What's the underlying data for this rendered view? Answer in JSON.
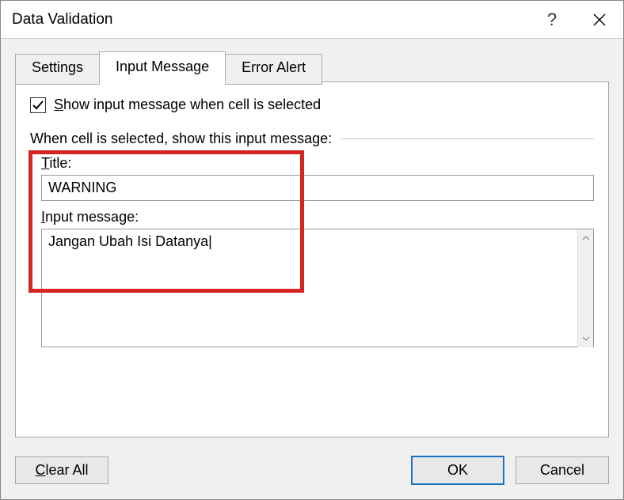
{
  "titlebar": {
    "title": "Data Validation",
    "help": "?",
    "close": "×"
  },
  "tabs": {
    "settings": "Settings",
    "input_message": "Input Message",
    "error_alert": "Error Alert"
  },
  "panel": {
    "checkbox_label_pre": "S",
    "checkbox_label_post": "how input message when cell is selected",
    "section_label": "When cell is selected, show this input message:",
    "title_label_pre": "T",
    "title_label_post": "itle:",
    "title_value": "WARNING",
    "input_msg_label_pre": "I",
    "input_msg_label_post": "nput message:",
    "input_msg_value": "Jangan Ubah Isi Datanya"
  },
  "buttons": {
    "clear_all_pre": "C",
    "clear_all_post": "lear All",
    "ok": "OK",
    "cancel": "Cancel"
  }
}
